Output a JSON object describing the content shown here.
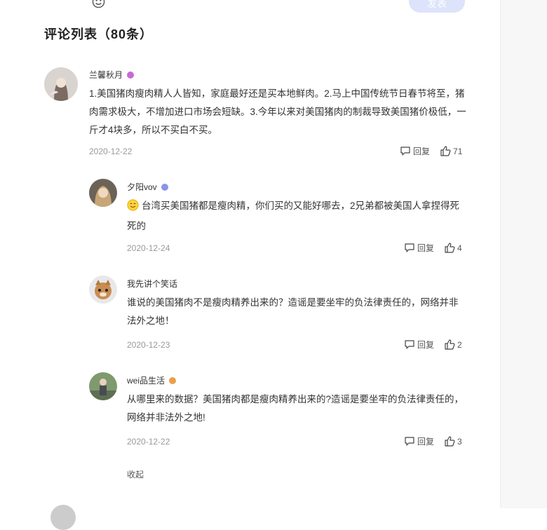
{
  "header": {
    "post_button_label": "发表",
    "list_title": "评论列表（80条）"
  },
  "comments": [
    {
      "user": "兰馨秋月",
      "text": "1.美国猪肉瘦肉精人人皆知，家庭最好还是买本地鲜肉。2.马上中国传统节日春节将至，猪肉需求极大，不增加进口市场会短缺。3.今年以来对美国猪肉的制裁导致美国猪价极低，一斤才4块多，所以不买白不买。",
      "date": "2020-12-22",
      "reply_label": "回复",
      "likes": "71",
      "badge_color": "#c86ad8"
    },
    {
      "user": "夕阳vov",
      "text": "台湾买美国猪都是瘦肉精，你们买的又能好哪去，2兄弟都被美国人拿捏得死死的",
      "date": "2020-12-24",
      "reply_label": "回复",
      "likes": "4",
      "badge_color": "#8a94e8"
    },
    {
      "user": "我先讲个笑话",
      "text": "谁说的美国猪肉不是瘦肉精养出来的？造谣是要坐牢的负法律责任的，网络并非法外之地！",
      "date": "2020-12-23",
      "reply_label": "回复",
      "likes": "2"
    },
    {
      "user": "wei品生活",
      "text": "从哪里来的数据？美国猪肉都是瘦肉精养出来的?造谣是要坐牢的负法律责任的，网络并非法外之地!",
      "date": "2020-12-22",
      "reply_label": "回复",
      "likes": "3",
      "badge_color": "#e8a04a"
    }
  ],
  "collapse_label": "收起"
}
